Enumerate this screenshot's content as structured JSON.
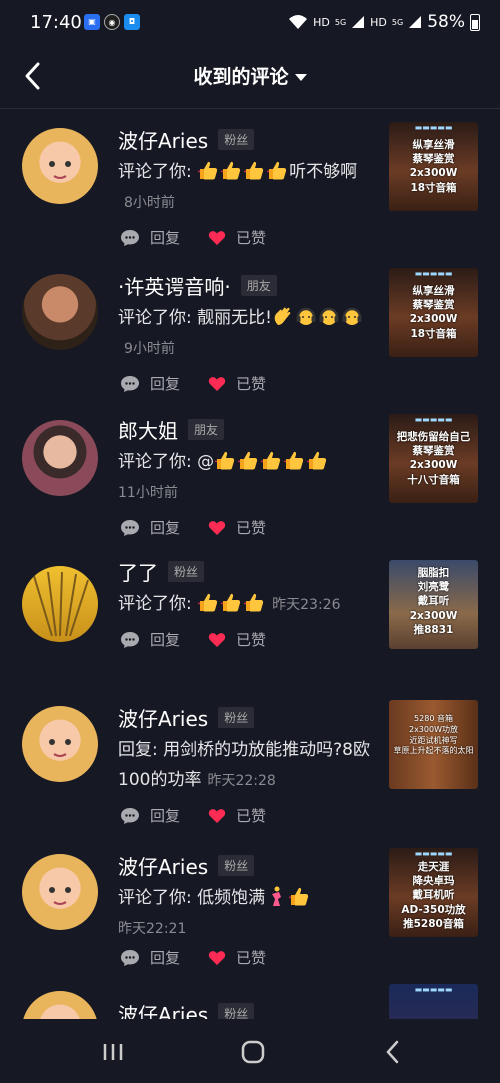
{
  "status": {
    "time": "17:40",
    "battery": "58%",
    "network": [
      "HD",
      "5G",
      "HD",
      "5G"
    ],
    "app_icons": [
      "app-icon-blue",
      "idm-icon",
      "shield-app-icon"
    ]
  },
  "header": {
    "title": "收到的评论"
  },
  "items": [
    {
      "name": "波仔Aries",
      "tag": "粉丝",
      "comment": "评论了你: ",
      "emoji_after": [
        "thumbs-up",
        "thumbs-up",
        "thumbs-up",
        "thumbs-up"
      ],
      "comment_tail": "听不够啊",
      "time": "8小时前",
      "reply": "回复",
      "liked": "已赞",
      "thumb_lines": [
        "纵享丝滑",
        "蔡琴鉴赏",
        "2x300W",
        "18寸音箱"
      ]
    },
    {
      "name": "·许英谔音响·",
      "tag": "朋友",
      "comment": "评论了你: 靓丽无比!",
      "emoji_after": [
        "wave",
        "headphones",
        "headphones",
        "headphones"
      ],
      "comment_tail": "",
      "time": "9小时前",
      "reply": "回复",
      "liked": "已赞",
      "thumb_lines": [
        "纵享丝滑",
        "蔡琴鉴赏",
        "2x300W",
        "18寸音箱"
      ]
    },
    {
      "name": "郎大姐",
      "tag": "朋友",
      "comment": "评论了你: @",
      "emoji_after": [
        "thumbs-up",
        "thumbs-up",
        "thumbs-up",
        "thumbs-up",
        "thumbs-up"
      ],
      "comment_tail": "",
      "time": "11小时前",
      "reply": "回复",
      "liked": "已赞",
      "thumb_lines": [
        "把悲伤留给自己",
        "蔡琴鉴赏",
        "2x300W",
        "十八寸音箱"
      ]
    },
    {
      "name": "了了",
      "tag": "粉丝",
      "comment": "评论了你: ",
      "emoji_after": [
        "thumbs-up",
        "thumbs-up",
        "thumbs-up"
      ],
      "comment_tail": "",
      "time": "昨天23:26",
      "reply": "回复",
      "liked": "已赞",
      "thumb_lines": [
        "胭脂扣",
        "刘亮鹭",
        "戴耳听",
        "2x300W",
        "推8831"
      ]
    },
    {
      "name": "波仔Aries",
      "tag": "粉丝",
      "comment": "回复: 用剑桥的功放能推动吗?8欧100的功率",
      "emoji_after": [],
      "comment_tail": "",
      "time": "昨天22:28",
      "reply": "回复",
      "liked": "已赞",
      "thumb_lines": [
        "5280 音箱",
        "2x300W功放",
        "近距试机神写",
        "草原上升起不落的太阳"
      ]
    },
    {
      "name": "波仔Aries",
      "tag": "粉丝",
      "comment": "评论了你: 低频饱满",
      "emoji_after": [
        "dancing",
        "thumbs-up"
      ],
      "comment_tail": "",
      "time": "昨天22:21",
      "reply": "回复",
      "liked": "已赞",
      "thumb_lines": [
        "走天涯",
        "降央卓玛",
        "戴耳机听",
        "AD-350功放",
        "推5280音箱"
      ]
    },
    {
      "name": "波仔Aries",
      "tag": "粉丝",
      "comment": "",
      "emoji_after": [],
      "comment_tail": "",
      "time": "",
      "reply": "",
      "liked": "",
      "thumb_lines": []
    }
  ],
  "colors": {
    "background": "#161823",
    "heart": "#fe2c55",
    "muted": "#a9aab0"
  }
}
